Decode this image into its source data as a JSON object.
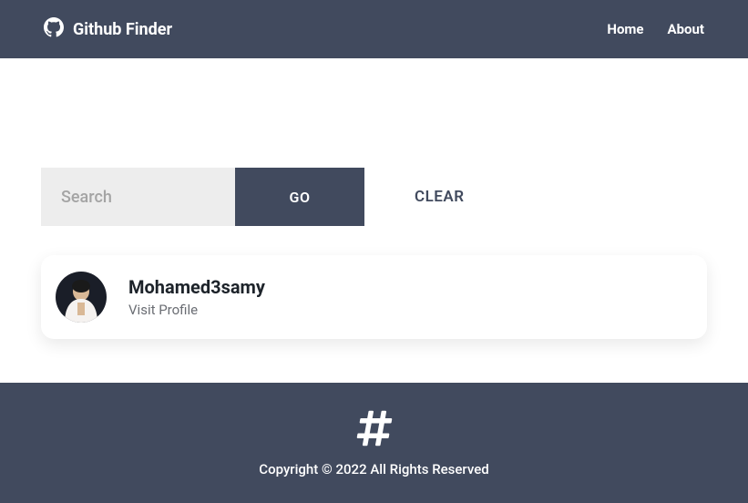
{
  "navbar": {
    "brand": "Github Finder",
    "links": {
      "home": "Home",
      "about": "About"
    }
  },
  "search": {
    "placeholder": "Search",
    "value": "",
    "go_label": "GO",
    "clear_label": "CLEAR"
  },
  "results": {
    "user": {
      "username": "Mohamed3samy",
      "profile_link": "Visit Profile"
    }
  },
  "footer": {
    "copyright": "Copyright © 2022 All Rights Reserved"
  }
}
